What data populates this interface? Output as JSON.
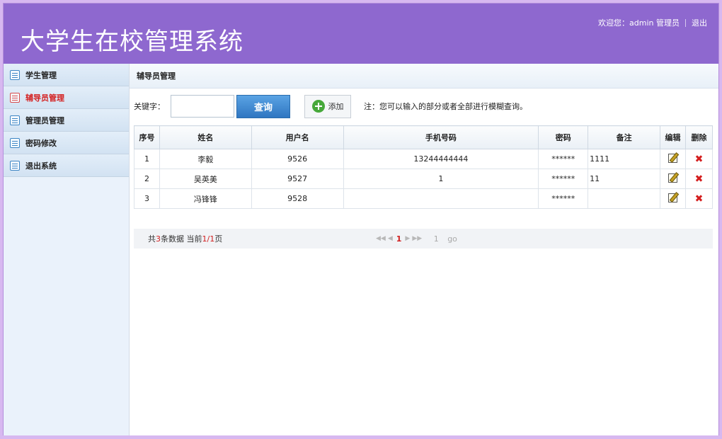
{
  "header": {
    "title": "大学生在校管理系统",
    "welcome": "欢迎您：admin 管理员",
    "logout": "退出"
  },
  "sidebar": {
    "items": [
      {
        "label": "学生管理",
        "icon": "list-icon",
        "active": false
      },
      {
        "label": "辅导员管理",
        "icon": "list-icon",
        "active": true
      },
      {
        "label": "管理员管理",
        "icon": "list-icon",
        "active": false
      },
      {
        "label": "密码修改",
        "icon": "list-icon",
        "active": false
      },
      {
        "label": "退出系统",
        "icon": "list-icon",
        "active": false
      }
    ]
  },
  "main": {
    "breadcrumb": "辅导员管理",
    "search": {
      "label": "关键字：",
      "value": "",
      "button": "查询"
    },
    "add_label": "添加",
    "tip": "注：您可以输入的部分或者全部进行模糊查询。",
    "table": {
      "headers": [
        "序号",
        "姓名",
        "用户名",
        "手机号码",
        "密码",
        "备注",
        "编辑",
        "删除"
      ],
      "rows": [
        {
          "no": "1",
          "name": "李毅",
          "username": "9526",
          "phone": "13244444444",
          "password": "******",
          "remark": "1111"
        },
        {
          "no": "2",
          "name": "吴英美",
          "username": "9527",
          "phone": "1",
          "password": "******",
          "remark": "11"
        },
        {
          "no": "3",
          "name": "冯锋锋",
          "username": "9528",
          "phone": "",
          "password": "******",
          "remark": ""
        }
      ]
    },
    "pager": {
      "total_prefix": "共",
      "total": "3",
      "total_mid": "条数据 当前",
      "current": "1",
      "slash": "/",
      "pages": "1",
      "total_suffix": "页",
      "nav_first": "◀◀",
      "nav_prev": "◀",
      "nav_current": "1",
      "nav_next": "▶",
      "nav_last": "▶▶",
      "jump_value": "1",
      "go_label": "go"
    }
  },
  "colors": {
    "header_bg": "#8e68cf",
    "active_item": "#d42020",
    "search_button": "#3a84cf"
  }
}
